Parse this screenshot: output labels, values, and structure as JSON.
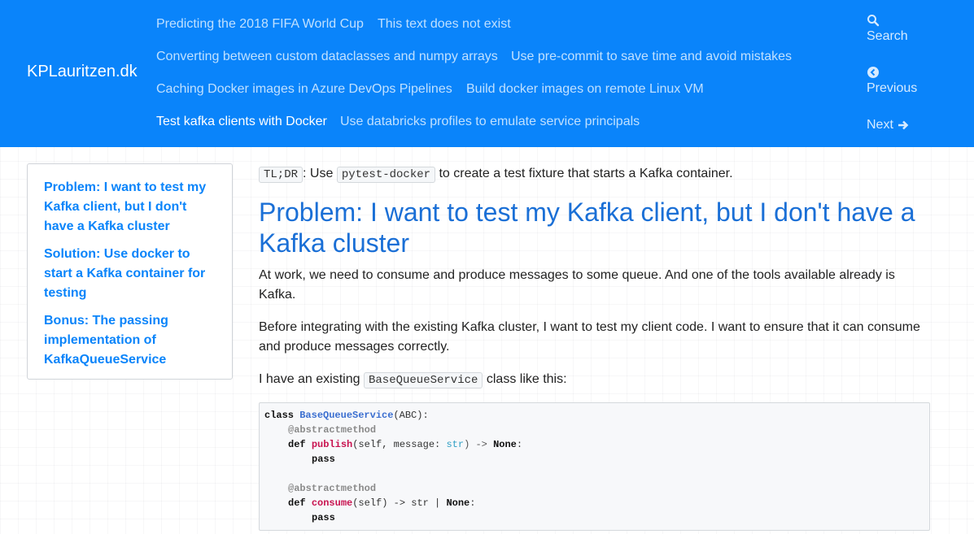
{
  "site": {
    "brand": "KPLauritzen.dk"
  },
  "nav": {
    "links": [
      "Predicting the 2018 FIFA World Cup",
      "This text does not exist",
      "Converting between custom dataclasses and numpy arrays",
      "Use pre-commit to save time and avoid mistakes",
      "Caching Docker images in Azure DevOps Pipelines",
      "Build docker images on remote Linux VM",
      "Test kafka clients with Docker",
      "Use databricks profiles to emulate service principals"
    ],
    "active": "Test kafka clients with Docker",
    "search_label": "Search",
    "previous_label": "Previous",
    "next_label": "Next"
  },
  "toc": {
    "items": [
      "Problem: I want to test my Kafka client, but I don't have a Kafka cluster",
      "Solution: Use docker to start a Kafka container for testing",
      "Bonus: The passing implementation of KafkaQueueService"
    ]
  },
  "article": {
    "tldr_code": "TL;DR",
    "tldr_text1": ": Use",
    "tldr_code2": "pytest-docker",
    "tldr_text2": "to create a test fixture that starts a Kafka container.",
    "heading": "Problem: I want to test my Kafka client, but I don't have a Kafka cluster",
    "para1": "At work, we need to consume and produce messages to some queue. And one of the tools available already is Kafka.",
    "para2": "Before integrating with the existing Kafka cluster, I want to test my client code. I want to ensure that it can consume and produce messages correctly.",
    "para3_pre": "I have an existing",
    "para3_code": "BaseQueueService",
    "para3_post": "class like this:"
  },
  "code": {
    "l1_kw": "class",
    "l1_name": "BaseQueueService",
    "l1_rest": "(ABC):",
    "l2_dec": "@abstractmethod",
    "l3_kw": "def",
    "l3_name": "publish",
    "l3_args": "(self, message: ",
    "l3_type": "str",
    "l3_arrow": ") -> ",
    "l3_ret": "None",
    "l3_colon": ":",
    "l4_pass": "pass",
    "l6_dec": "@abstractmethod",
    "l7_kw": "def",
    "l7_name": "consume",
    "l7_args": "(self) -> str | ",
    "l7_ret": "None",
    "l7_colon": ":",
    "l8_pass": "pass"
  },
  "colors": {
    "navbar": "#0a84fa",
    "link": "#0a84fa",
    "heading": "#1a6fd6"
  },
  "icons": {
    "search": "search-icon",
    "previous": "arrow-left-circle-icon",
    "next": "arrow-right-icon"
  }
}
